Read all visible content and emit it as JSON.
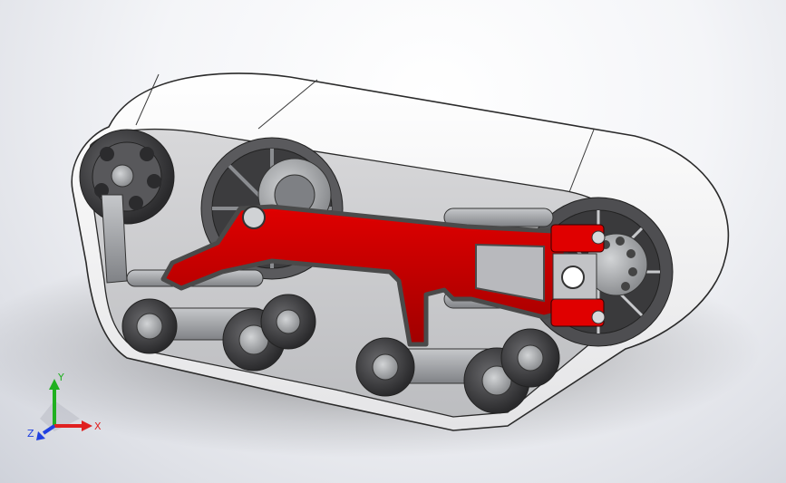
{
  "viewport": {
    "background_top": "#ffffff",
    "background_bottom": "#cfd2da"
  },
  "model": {
    "colors": {
      "track": "#f7f7f7",
      "track_edge": "#2a2a2a",
      "frame_red": "#c40000",
      "frame_steel": "#9a9ca0",
      "wheel_dark": "#3c3c3e",
      "wheel_hub": "#a9abad",
      "accent_red": "#e00000"
    }
  },
  "triad": {
    "x_label": "X",
    "y_label": "Y",
    "z_label": "Z",
    "x_color": "#e02020",
    "y_color": "#20b020",
    "z_color": "#2040e0"
  }
}
